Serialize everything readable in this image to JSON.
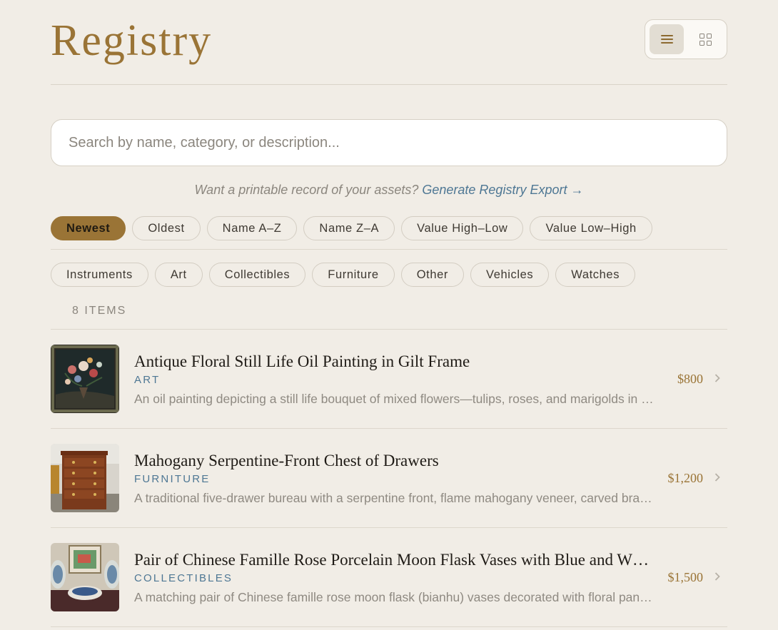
{
  "header": {
    "title": "Registry",
    "view_modes": [
      {
        "name": "list",
        "icon": "list-icon",
        "active": true
      },
      {
        "name": "grid",
        "icon": "grid-icon",
        "active": false
      }
    ]
  },
  "search": {
    "placeholder": "Search by name, category, or description...",
    "value": ""
  },
  "export": {
    "prompt": "Want a printable record of your assets?",
    "link_label": "Generate Registry Export →"
  },
  "sort_options": [
    {
      "label": "Newest",
      "active": true
    },
    {
      "label": "Oldest",
      "active": false
    },
    {
      "label": "Name A–Z",
      "active": false
    },
    {
      "label": "Name Z–A",
      "active": false
    },
    {
      "label": "Value High–Low",
      "active": false
    },
    {
      "label": "Value Low–High",
      "active": false
    }
  ],
  "categories": [
    "Instruments",
    "Art",
    "Collectibles",
    "Furniture",
    "Other",
    "Vehicles",
    "Watches"
  ],
  "item_count_label": "8 ITEMS",
  "items": [
    {
      "name": "Antique Floral Still Life Oil Painting in Gilt Frame",
      "category": "ART",
      "description": "An oil painting depicting a still life bouquet of mixed flowers—tulips, roses, and marigolds in a vase",
      "price": "$800"
    },
    {
      "name": "Mahogany Serpentine-Front Chest of Drawers",
      "category": "FURNITURE",
      "description": "A traditional five-drawer bureau with a serpentine front, flame mahogany veneer, carved brass pulls",
      "price": "$1,200"
    },
    {
      "name": "Pair of Chinese Famille Rose Porcelain Moon Flask Vases with Blue and White Decoration",
      "category": "COLLECTIBLES",
      "description": "A matching pair of Chinese famille rose moon flask (bianhu) vases decorated with floral panels",
      "price": "$1,500"
    }
  ],
  "colors": {
    "accent": "#9a7436",
    "link": "#4e7794",
    "background": "#f1ede6"
  }
}
